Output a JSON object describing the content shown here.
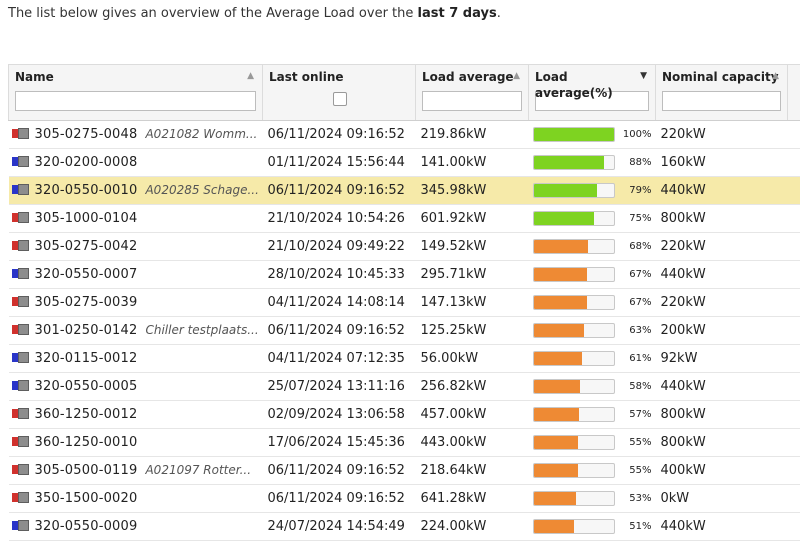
{
  "intro": {
    "prefix": "The list below gives an overview of the Average Load over the ",
    "bold": "last 7 days",
    "suffix": "."
  },
  "columns": {
    "name": "Name",
    "last_online": "Last online",
    "load_avg": "Load average",
    "load_pct": "Load average(%)",
    "nominal": "Nominal capacity"
  },
  "colors": {
    "green": "#7ed321",
    "orange": "#ee8a34",
    "highlight": "#f6eaa9",
    "icon_red": "#d0312d",
    "icon_blue": "#2a35c8"
  },
  "rows": [
    {
      "icon": "red-flag-device-icon",
      "serial": "305-0275-0048",
      "desc": "A021082 Womm...",
      "last_online": "06/11/2024 09:16:52",
      "load": "219.86kW",
      "pct": 100,
      "pct_label": "100%",
      "nominal": "220kW",
      "bar": "green"
    },
    {
      "icon": "blue-flag-device-icon",
      "serial": "320-0200-0008",
      "desc": "",
      "last_online": "01/11/2024 15:56:44",
      "load": "141.00kW",
      "pct": 88,
      "pct_label": "88%",
      "nominal": "160kW",
      "bar": "green"
    },
    {
      "icon": "blue-flag-device-icon",
      "serial": "320-0550-0010",
      "desc": "A020285 Schage...",
      "last_online": "06/11/2024 09:16:52",
      "load": "345.98kW",
      "pct": 79,
      "pct_label": "79%",
      "nominal": "440kW",
      "bar": "green",
      "highlight": true
    },
    {
      "icon": "red-flag-device-icon",
      "serial": "305-1000-0104",
      "desc": "",
      "last_online": "21/10/2024 10:54:26",
      "load": "601.92kW",
      "pct": 75,
      "pct_label": "75%",
      "nominal": "800kW",
      "bar": "green"
    },
    {
      "icon": "red-flag-device-icon",
      "serial": "305-0275-0042",
      "desc": "",
      "last_online": "21/10/2024 09:49:22",
      "load": "149.52kW",
      "pct": 68,
      "pct_label": "68%",
      "nominal": "220kW",
      "bar": "orange"
    },
    {
      "icon": "blue-flag-device-icon",
      "serial": "320-0550-0007",
      "desc": "",
      "last_online": "28/10/2024 10:45:33",
      "load": "295.71kW",
      "pct": 67,
      "pct_label": "67%",
      "nominal": "440kW",
      "bar": "orange"
    },
    {
      "icon": "red-flag-device-icon",
      "serial": "305-0275-0039",
      "desc": "",
      "last_online": "04/11/2024 14:08:14",
      "load": "147.13kW",
      "pct": 67,
      "pct_label": "67%",
      "nominal": "220kW",
      "bar": "orange"
    },
    {
      "icon": "red-flag-device-icon",
      "serial": "301-0250-0142",
      "desc": "Chiller testplaats...",
      "last_online": "06/11/2024 09:16:52",
      "load": "125.25kW",
      "pct": 63,
      "pct_label": "63%",
      "nominal": "200kW",
      "bar": "orange"
    },
    {
      "icon": "blue-flag-device-icon",
      "serial": "320-0115-0012",
      "desc": "",
      "last_online": "04/11/2024 07:12:35",
      "load": "56.00kW",
      "pct": 61,
      "pct_label": "61%",
      "nominal": "92kW",
      "bar": "orange"
    },
    {
      "icon": "blue-flag-device-icon",
      "serial": "320-0550-0005",
      "desc": "",
      "last_online": "25/07/2024 13:11:16",
      "load": "256.82kW",
      "pct": 58,
      "pct_label": "58%",
      "nominal": "440kW",
      "bar": "orange"
    },
    {
      "icon": "red-flag-device-icon",
      "serial": "360-1250-0012",
      "desc": "",
      "last_online": "02/09/2024 13:06:58",
      "load": "457.00kW",
      "pct": 57,
      "pct_label": "57%",
      "nominal": "800kW",
      "bar": "orange"
    },
    {
      "icon": "red-flag-device-icon",
      "serial": "360-1250-0010",
      "desc": "",
      "last_online": "17/06/2024 15:45:36",
      "load": "443.00kW",
      "pct": 55,
      "pct_label": "55%",
      "nominal": "800kW",
      "bar": "orange"
    },
    {
      "icon": "red-flag-device-icon",
      "serial": "305-0500-0119",
      "desc": "A021097 Rotter...",
      "last_online": "06/11/2024 09:16:52",
      "load": "218.64kW",
      "pct": 55,
      "pct_label": "55%",
      "nominal": "400kW",
      "bar": "orange"
    },
    {
      "icon": "red-flag-device-icon",
      "serial": "350-1500-0020",
      "desc": "",
      "last_online": "06/11/2024 09:16:52",
      "load": "641.28kW",
      "pct": 53,
      "pct_label": "53%",
      "nominal": "0kW",
      "bar": "orange"
    },
    {
      "icon": "blue-flag-device-icon",
      "serial": "320-0550-0009",
      "desc": "",
      "last_online": "24/07/2024 14:54:49",
      "load": "224.00kW",
      "pct": 51,
      "pct_label": "51%",
      "nominal": "440kW",
      "bar": "orange"
    }
  ]
}
